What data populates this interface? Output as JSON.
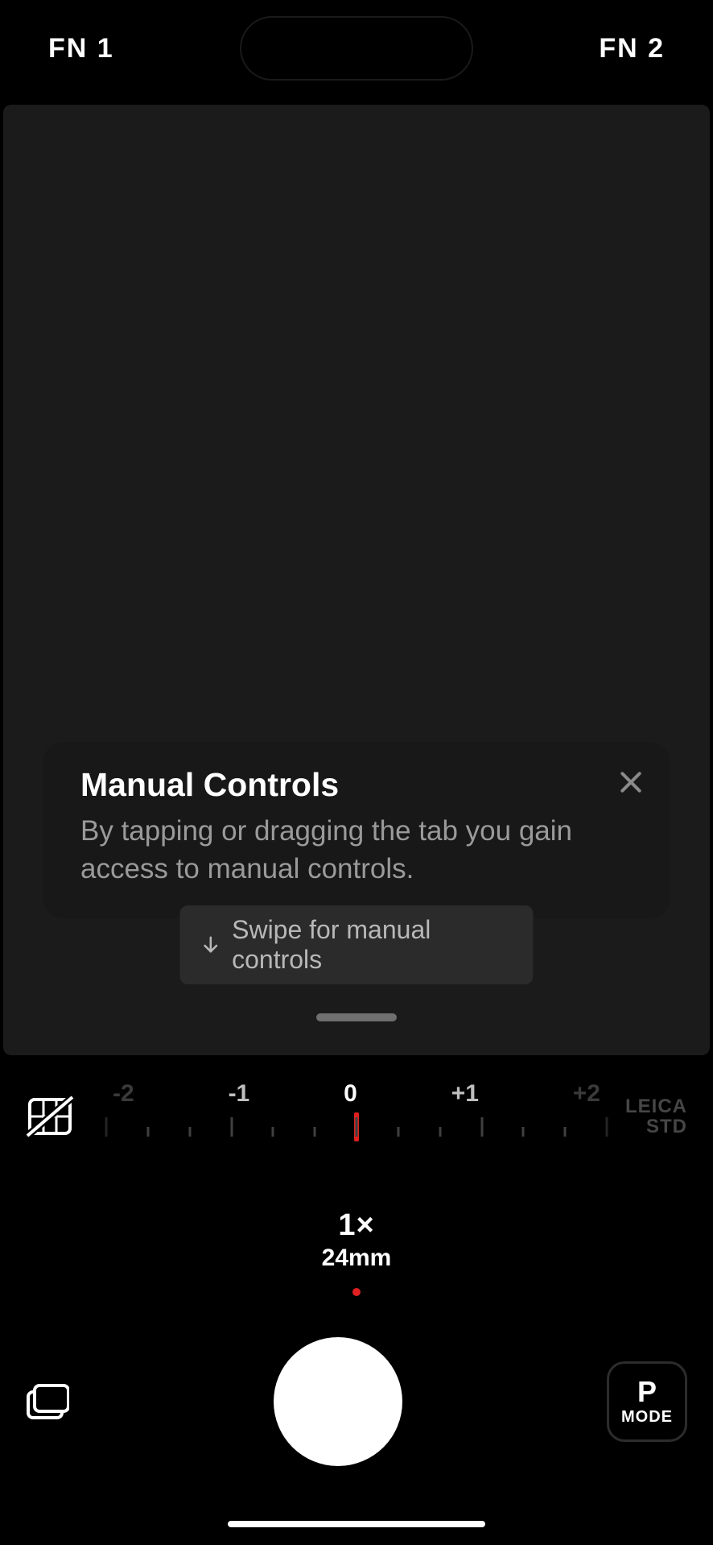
{
  "topbar": {
    "fn1": "FN 1",
    "fn2": "FN 2"
  },
  "tooltip": {
    "title": "Manual Controls",
    "body": "By tapping or dragging the tab you gain access to manual controls."
  },
  "swipe_hint": "Swipe for manual controls",
  "ev": {
    "labels": {
      "m2": "-2",
      "m1": "-1",
      "zero": "0",
      "p1": "+1",
      "p2": "+2"
    },
    "value": 0
  },
  "look": {
    "brand": "LEICA",
    "sub": "STD"
  },
  "zoom": {
    "multiplier": "1×",
    "focal": "24mm"
  },
  "mode": {
    "letter": "P",
    "label": "MODE"
  }
}
